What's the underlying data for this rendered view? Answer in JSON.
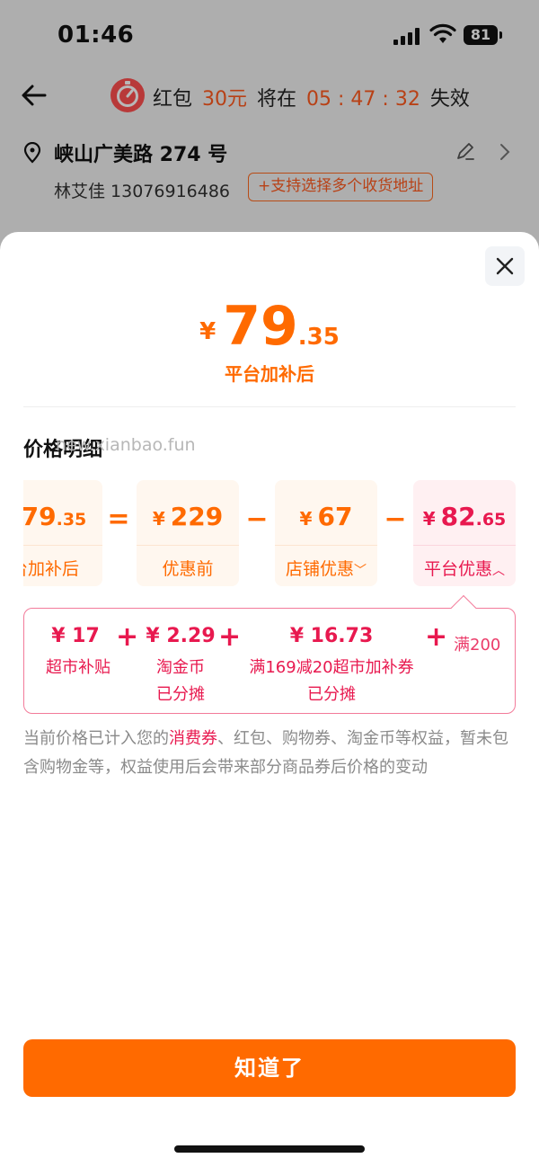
{
  "status_bar": {
    "time": "01:46",
    "battery": "81"
  },
  "header": {
    "redpacket_prefix": "红包",
    "redpacket_amount": "30元",
    "will": "将在",
    "countdown": "05 : 47 : 32",
    "expire": "失效"
  },
  "address": {
    "street": "峡山广美路 274 号",
    "contact": "林艾佳  13076916486",
    "multi_address_button": "+支持选择多个收货地址"
  },
  "sheet": {
    "price_symbol": "¥",
    "price_integer": "79",
    "price_decimal": ".35",
    "price_subtitle": "平台加补后",
    "section_title": "价格明细",
    "watermark": "new.xianbao.fun",
    "breakdown": [
      {
        "symbol": "¥",
        "integer": "79",
        "decimal": ".35",
        "label": "台加补后"
      },
      {
        "op": "="
      },
      {
        "symbol": "¥",
        "integer": "229",
        "decimal": "",
        "label": "优惠前"
      },
      {
        "op": "−"
      },
      {
        "symbol": "¥",
        "integer": "67",
        "decimal": "",
        "label": "店铺优惠",
        "chevron": "﹀"
      },
      {
        "op": "−"
      },
      {
        "symbol": "¥",
        "integer": "82",
        "decimal": ".65",
        "label": "平台优惠",
        "chevron": "︿"
      }
    ],
    "platform_details": [
      {
        "value": "¥ 17",
        "label": "超市补贴",
        "sub": ""
      },
      {
        "value": "¥ 2.29",
        "label": "淘金币",
        "sub": "已分摊"
      },
      {
        "value": "¥ 16.73",
        "label": "满169减20超市加补券",
        "sub": "已分摊"
      },
      {
        "value": "",
        "label": "满200",
        "sub": ""
      }
    ],
    "plus_sign": "+",
    "note_before": "当前价格已计入您的",
    "note_highlight": "消费券",
    "note_after": "、红包、购物券、淘金币等权益，暂未包含购物金等，权益使用后会带来部分商品券后价格的变动",
    "ok_button": "知道了"
  },
  "colors": {
    "orange": "#ff6a00",
    "pink": "#e8194f",
    "overlay": "rgba(0,0,0,0.28)"
  }
}
